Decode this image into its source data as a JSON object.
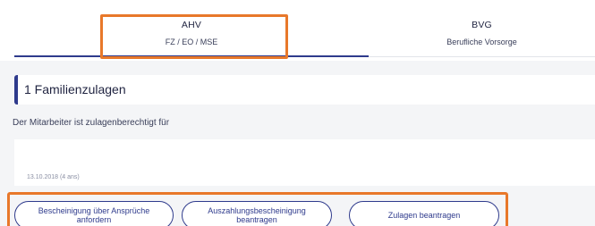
{
  "tabs": [
    {
      "title": "AHV",
      "subtitle": "FZ / EO / MSE"
    },
    {
      "title": "BVG",
      "subtitle": "Berufliche Vorsorge"
    }
  ],
  "section": {
    "title": "1 Familienzulagen"
  },
  "subtitle": "Der Mitarbeiter ist zulagenberechtigt für",
  "entry": {
    "date": "13.10.2018 (4 ans)"
  },
  "actions": {
    "btn1": "Bescheinigung über Ansprüche anfordern",
    "btn2": "Auszahlungsbescheinigung beantragen",
    "btn3": "Zulagen beantragen"
  },
  "colors": {
    "accent": "#2e3a8c",
    "highlight": "#e8782a"
  }
}
